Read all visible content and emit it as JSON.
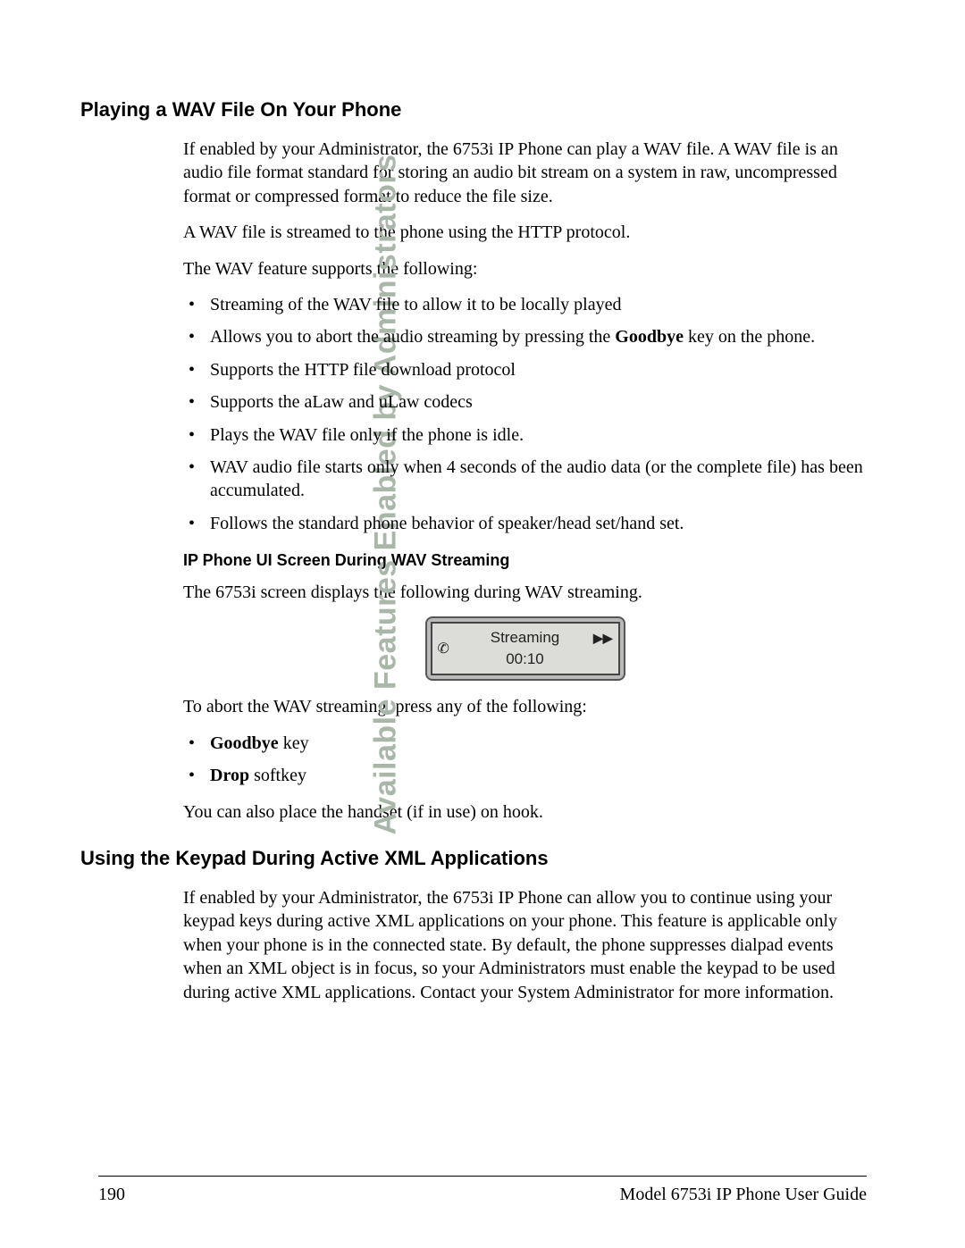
{
  "side_title": "Available Features Enabled by Administrators",
  "section1": {
    "heading": "Playing a WAV File On Your Phone",
    "para1": "If enabled by your Administrator, the 6753i IP Phone can play a WAV file. A WAV file is an audio file format standard for storing an audio bit stream on a system in raw, uncompressed format or compressed format to reduce the file size.",
    "para2": "A WAV file is streamed to the phone using the HTTP protocol.",
    "para3": "The WAV feature supports the following:",
    "bullets": [
      {
        "text": "Streaming of the WAV file to allow it to be locally played"
      },
      {
        "prefix": "Allows you to abort the audio streaming by pressing the ",
        "bold": "Goodbye",
        "suffix": " key on the phone."
      },
      {
        "text": "Supports the HTTP file download protocol"
      },
      {
        "text": "Supports the aLaw and uLaw codecs"
      },
      {
        "text": "Plays the WAV file only if the phone is idle."
      },
      {
        "text": "WAV audio file starts only when 4 seconds of the audio data (or the complete file) has been accumulated."
      },
      {
        "text": "Follows the standard phone behavior of speaker/head set/hand set."
      }
    ],
    "subheading": "IP Phone UI Screen During WAV Streaming",
    "para4": "The 6753i screen displays the following during WAV streaming.",
    "lcd": {
      "line1": "Streaming",
      "line2": "00:10",
      "icon_left": "phone-handset-icon",
      "icon_right": "fast-forward-icon"
    },
    "para5": "To abort the WAV streaming, press any of the following:",
    "abort_bullets": [
      {
        "bold": "Goodbye",
        "suffix": " key"
      },
      {
        "bold": "Drop",
        "suffix": " softkey"
      }
    ],
    "para6": "You can also place the handset (if in use) on hook."
  },
  "section2": {
    "heading": "Using the Keypad During Active XML Applications",
    "para1": "If enabled by your Administrator, the 6753i IP Phone can allow you to continue using your keypad keys during active XML applications on your phone. This feature is applicable only when your phone is in the connected state. By default, the phone suppresses dialpad events when an XML object is in focus, so your Administrators must enable the keypad to be used during active XML applications. Contact your System Administrator for more information."
  },
  "footer": {
    "page_number": "190",
    "guide_title": "Model 6753i IP Phone User Guide"
  }
}
